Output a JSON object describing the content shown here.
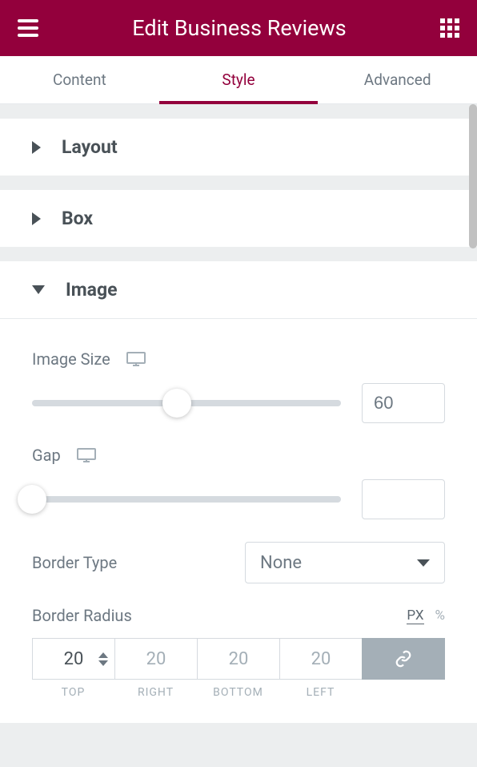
{
  "header": {
    "title": "Edit Business Reviews"
  },
  "tabs": {
    "content": "Content",
    "style": "Style",
    "advanced": "Advanced"
  },
  "sections": {
    "layout": {
      "title": "Layout"
    },
    "box": {
      "title": "Box"
    },
    "image": {
      "title": "Image",
      "image_size": {
        "label": "Image Size",
        "value": "60",
        "percent": 47
      },
      "gap": {
        "label": "Gap",
        "value": "",
        "percent": 0
      },
      "border_type": {
        "label": "Border Type",
        "value": "None"
      },
      "border_radius": {
        "label": "Border Radius",
        "unit_px": "PX",
        "unit_percent": "%",
        "top": "20",
        "right": "20",
        "bottom": "20",
        "left": "20",
        "label_top": "TOP",
        "label_right": "RIGHT",
        "label_bottom": "BOTTOM",
        "label_left": "LEFT"
      }
    }
  }
}
